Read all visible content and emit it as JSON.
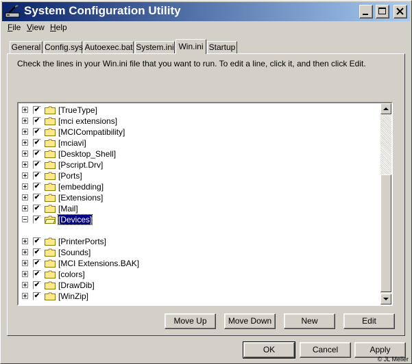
{
  "window": {
    "title": "System Configuration Utility",
    "titlebar_colors": [
      "#0a246a",
      "#a6caf0"
    ]
  },
  "menu": [
    {
      "label": "File",
      "mnemonic": "F",
      "rest": "ile"
    },
    {
      "label": "View",
      "mnemonic": "V",
      "rest": "iew"
    },
    {
      "label": "Help",
      "mnemonic": "H",
      "rest": "elp"
    }
  ],
  "tabs": [
    {
      "label": "General",
      "active": false
    },
    {
      "label": "Config.sys",
      "active": false
    },
    {
      "label": "Autoexec.bat",
      "active": false
    },
    {
      "label": "System.ini",
      "active": false
    },
    {
      "label": "Win.ini",
      "active": true
    },
    {
      "label": "Startup",
      "active": false
    }
  ],
  "instructions": "Check the lines in your Win.ini file that you want to run. To edit a line, click it, and then click Edit.",
  "tree_items": [
    {
      "label": "[TrueType]",
      "checked": true,
      "expanded": false
    },
    {
      "label": "[mci extensions]",
      "checked": true,
      "expanded": false
    },
    {
      "label": "[MCICompatibility]",
      "checked": true,
      "expanded": false
    },
    {
      "label": "[mciavi]",
      "checked": true,
      "expanded": false
    },
    {
      "label": "[Desktop_Shell]",
      "checked": true,
      "expanded": false
    },
    {
      "label": "[Pscript.Drv]",
      "checked": true,
      "expanded": false
    },
    {
      "label": "[Ports]",
      "checked": true,
      "expanded": false
    },
    {
      "label": "[embedding]",
      "checked": true,
      "expanded": false
    },
    {
      "label": "[Extensions]",
      "checked": true,
      "expanded": false
    },
    {
      "label": "[Mail]",
      "checked": true,
      "expanded": false
    },
    {
      "label": "[Devices]",
      "checked": true,
      "expanded": true,
      "selected": true
    },
    {
      "label": "[PrinterPorts]",
      "checked": true,
      "expanded": false
    },
    {
      "label": "[Sounds]",
      "checked": true,
      "expanded": false
    },
    {
      "label": "[MCI Extensions.BAK]",
      "checked": true,
      "expanded": false
    },
    {
      "label": "[colors]",
      "checked": true,
      "expanded": false
    },
    {
      "label": "[DrawDib]",
      "checked": true,
      "expanded": false
    },
    {
      "label": "[WinZip]",
      "checked": true,
      "expanded": false
    }
  ],
  "edit_buttons": {
    "move_up": "Move Up",
    "move_down": "Move Down",
    "new": "New",
    "edit": "Edit"
  },
  "dialog_buttons": {
    "ok": "OK",
    "cancel": "Cancel",
    "apply": "Apply"
  },
  "copyright": "© JL Meller",
  "colors": {
    "face": "#d4d0c8",
    "folder": "#ffe88a",
    "selection": "#000080"
  }
}
